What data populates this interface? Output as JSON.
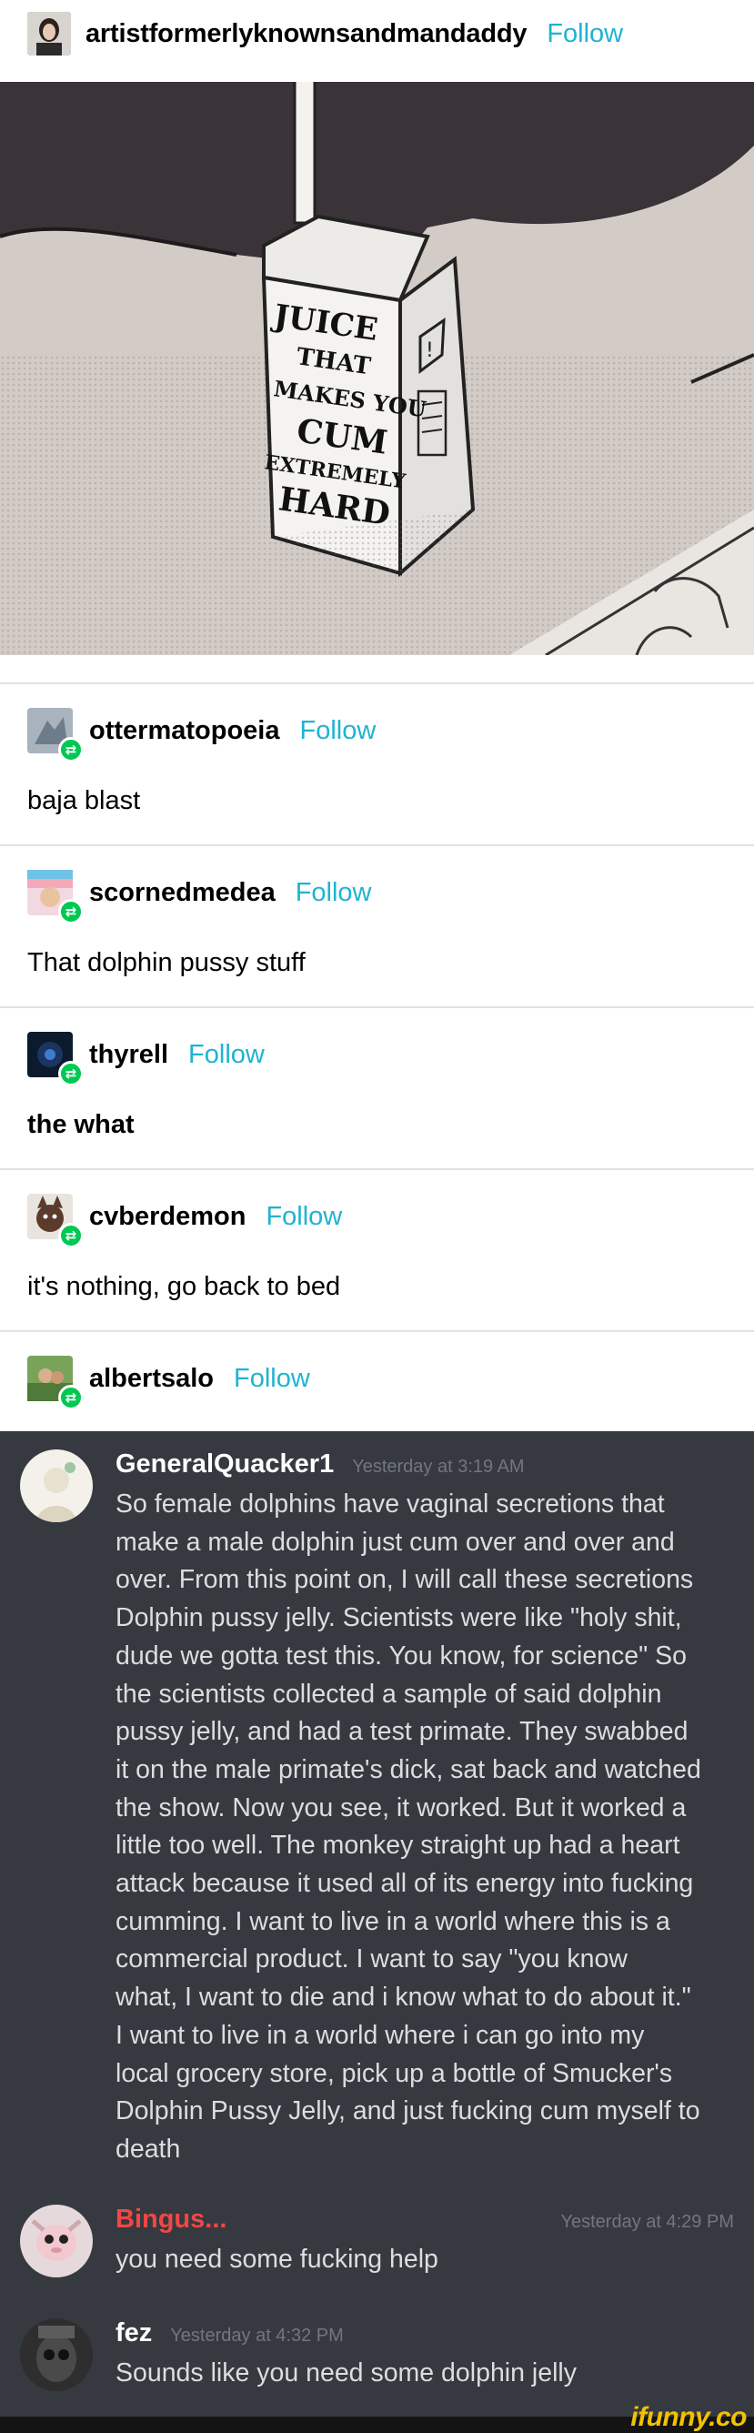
{
  "op": {
    "username": "artistformerlyknownsandmandaddy",
    "follow_label": "Follow"
  },
  "image": {
    "box_lines": [
      "JUICE",
      "THAT",
      "MAKES YOU",
      "CUM",
      "EXTREMELY",
      "HARD"
    ]
  },
  "reblogs": [
    {
      "username": "ottermatopoeia",
      "follow_label": "Follow",
      "text": "baja blast",
      "bold": false
    },
    {
      "username": "scornedmedea",
      "follow_label": "Follow",
      "text": "That dolphin pussy stuff",
      "bold": false
    },
    {
      "username": "thyrell",
      "follow_label": "Follow",
      "text": "the what",
      "bold": true
    },
    {
      "username": "cvberdemon",
      "follow_label": "Follow",
      "text": "it's nothing, go back to bed",
      "bold": false
    },
    {
      "username": "albertsalo",
      "follow_label": "Follow",
      "text": "",
      "bold": false
    }
  ],
  "discord": {
    "messages": [
      {
        "author": "GeneralQuacker1",
        "timestamp": "Yesterday at 3:19 AM",
        "author_color": "#ffffff",
        "lines": [
          "So female dolphins have vaginal secretions that",
          "make a male dolphin just cum over and over and",
          "over. From this point on, I will call these secretions",
          "Dolphin pussy jelly. Scientists were like \"holy shit,",
          "dude we gotta test this. You know, for science\" So",
          "the scientists collected a sample of said dolphin",
          "pussy jelly, and had a test primate. They swabbed",
          "it on the male primate's dick, sat back and watched",
          "the show. Now you see, it worked. But it worked a",
          "little too well. The monkey straight up had a heart",
          "attack because it used all of its energy into fucking",
          "cumming. I want to live in a world where this is a",
          "commercial product. I want to say \"you know",
          "what, I want to die and i know what to do about it.\"",
          "I want to live in a world where i can go into my",
          "local grocery store, pick up a bottle of Smucker's",
          "Dolphin Pussy Jelly, and just fucking cum myself to",
          "death"
        ]
      },
      {
        "author": "Bingus...",
        "timestamp": "Yesterday at 4:29 PM",
        "author_color": "#f04747",
        "lines": [
          "you need some fucking help"
        ]
      },
      {
        "author": "fez",
        "timestamp": "Yesterday at 4:32 PM",
        "author_color": "#ffffff",
        "lines": [
          "Sounds like you need some dolphin jelly"
        ]
      }
    ]
  },
  "watermark": "ifunny.co"
}
